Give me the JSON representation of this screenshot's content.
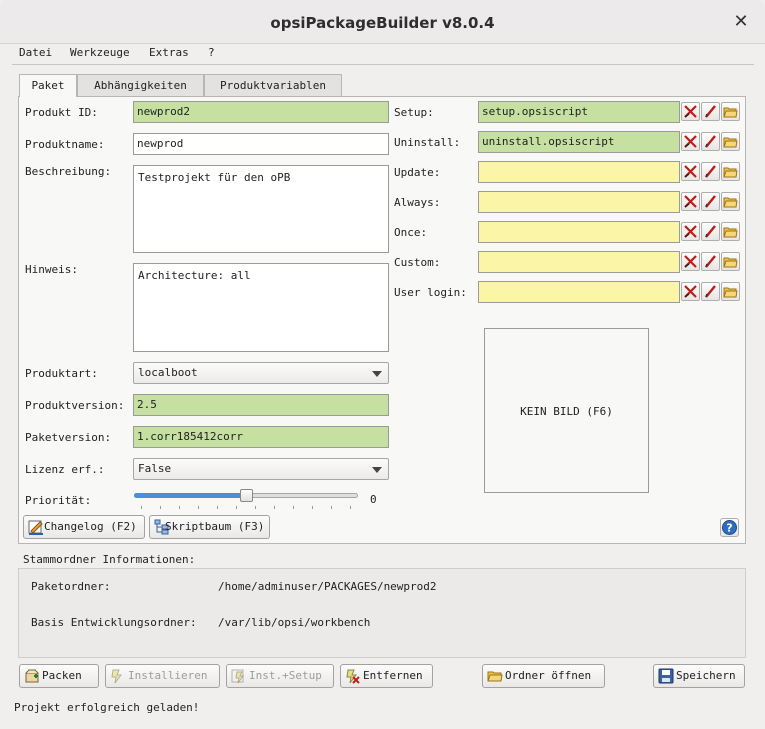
{
  "window": {
    "title": "opsiPackageBuilder v8.0.4",
    "close_icon": "close-icon"
  },
  "menu": {
    "items": [
      "Datei",
      "Werkzeuge",
      "Extras",
      "?"
    ]
  },
  "tabs": [
    "Paket",
    "Abhängigkeiten",
    "Produktvariablen"
  ],
  "form": {
    "product_id": {
      "label": "Produkt ID:",
      "value": "newprod2"
    },
    "product_name": {
      "label": "Produktname:",
      "value": "newprod"
    },
    "description": {
      "label": "Beschreibung:",
      "value": "Testprojekt für den oPB"
    },
    "advice": {
      "label": "Hinweis:",
      "value": "Architecture: all"
    },
    "product_type": {
      "label": "Produktart:",
      "value": "localboot"
    },
    "product_version": {
      "label": "Produktversion:",
      "value": "2.5"
    },
    "package_version": {
      "label": "Paketversion:",
      "value": "1.corr185412corr"
    },
    "license": {
      "label": "Lizenz erf.:",
      "value": "False"
    },
    "priority": {
      "label": "Priorität:",
      "value": "0",
      "fraction": 0.5
    }
  },
  "scripts": [
    {
      "label": "Setup:",
      "value": "setup.opsiscript",
      "state": "green"
    },
    {
      "label": "Uninstall:",
      "value": "uninstall.opsiscript",
      "state": "green"
    },
    {
      "label": "Update:",
      "value": "",
      "state": "yellow"
    },
    {
      "label": "Always:",
      "value": "",
      "state": "yellow"
    },
    {
      "label": "Once:",
      "value": "",
      "state": "yellow"
    },
    {
      "label": "Custom:",
      "value": "",
      "state": "yellow"
    },
    {
      "label": "User login:",
      "value": "",
      "state": "yellow"
    }
  ],
  "image_placeholder": "KEIN BILD (F6)",
  "panel_buttons": {
    "changelog": "Changelog (F2)",
    "scripttree": "Skriptbaum (F3)"
  },
  "info": {
    "heading": "Stammordner Informationen:",
    "package_folder_label": "Paketordner:",
    "package_folder_value": "/home/adminuser/PACKAGES/newprod2",
    "workbench_label": "Basis Entwicklungsordner:",
    "workbench_value": "/var/lib/opsi/workbench"
  },
  "actions": {
    "pack": "Packen",
    "install": "Installieren",
    "install_setup": "Inst.+Setup",
    "remove": "Entfernen",
    "open_folder": "Ordner öffnen",
    "save": "Speichern"
  },
  "status": "Projekt erfolgreich geladen!",
  "colors": {
    "valid": "#c5e0a0",
    "empty": "#fbf5a8",
    "accent": "#4a90d9"
  }
}
